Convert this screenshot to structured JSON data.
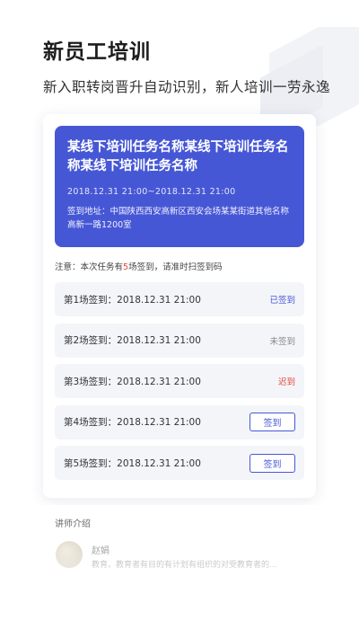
{
  "header": {
    "title": "新员工培训",
    "subtitle": "新入职转岗晋升自动识别，新人培训一劳永逸"
  },
  "task": {
    "name": "某线下培训任务名称某线下培训任务名称某线下培训任务名称",
    "time": "2018.12.31   21:00~2018.12.31   21:00",
    "address": "签到地址：中国陕西西安高新区西安会场某某街道其他名称高新一路1200室"
  },
  "notice": {
    "prefix": "注意：本次任务有",
    "count": "5",
    "suffix": "场签到，请准时扫签到码"
  },
  "sessions": [
    {
      "label": "第1场签到：2018.12.31   21:00",
      "status": "已签到",
      "state": "signed"
    },
    {
      "label": "第2场签到：2018.12.31   21:00",
      "status": "未签到",
      "state": "unsigned"
    },
    {
      "label": "第3场签到：2018.12.31   21:00",
      "status": "迟到",
      "state": "late"
    },
    {
      "label": "第4场签到：2018.12.31   21:00",
      "button": "签到",
      "state": "pending"
    },
    {
      "label": "第5场签到：2018.12.31   21:00",
      "button": "签到",
      "state": "pending"
    }
  ],
  "lecturer": {
    "section_title": "讲师介绍",
    "name": "赵娟",
    "description": "教育。教育者有目的有计划有组织的对受教育者的..."
  },
  "colors": {
    "primary": "#4657d6",
    "late": "#e0493d",
    "row_bg": "#f4f5f9"
  }
}
